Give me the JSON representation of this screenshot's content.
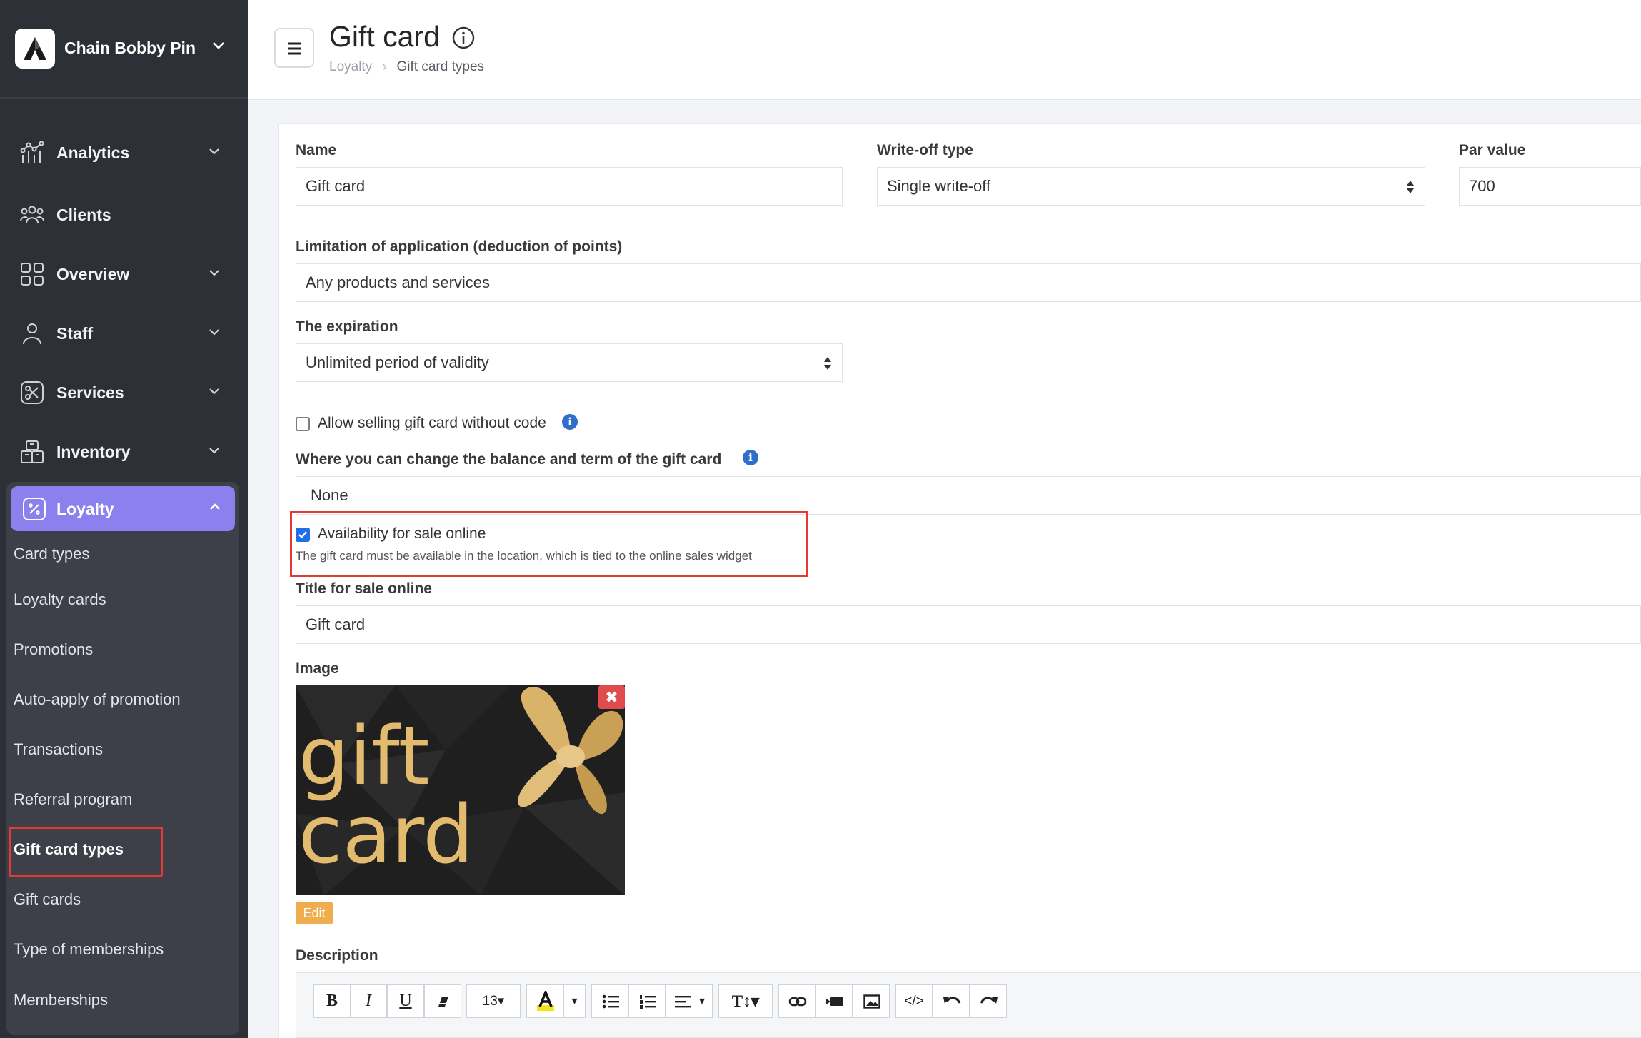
{
  "brand": {
    "name": "Chain Bobby Pin"
  },
  "sidebar": {
    "items": [
      {
        "label": "Analytics",
        "icon": "analytics-icon",
        "has_chevron": true
      },
      {
        "label": "Clients",
        "icon": "clients-icon",
        "has_chevron": false
      },
      {
        "label": "Overview",
        "icon": "overview-icon",
        "has_chevron": true
      },
      {
        "label": "Staff",
        "icon": "staff-icon",
        "has_chevron": true
      },
      {
        "label": "Services",
        "icon": "services-icon",
        "has_chevron": true
      },
      {
        "label": "Inventory",
        "icon": "inventory-icon",
        "has_chevron": true
      }
    ],
    "loyalty": {
      "label": "Loyalty",
      "icon": "loyalty-icon",
      "accent_color": "#8a80ee",
      "sub_items": [
        {
          "label": "Card types",
          "active": false
        },
        {
          "label": "Loyalty cards",
          "active": false
        },
        {
          "label": "Promotions",
          "active": false
        },
        {
          "label": "Auto-apply of promotion",
          "active": false
        },
        {
          "label": "Transactions",
          "active": false
        },
        {
          "label": "Referral program",
          "active": false
        },
        {
          "label": "Gift card types",
          "active": true
        },
        {
          "label": "Gift cards",
          "active": false
        },
        {
          "label": "Type of memberships",
          "active": false
        },
        {
          "label": "Memberships",
          "active": false
        }
      ]
    }
  },
  "header": {
    "title": "Gift card",
    "breadcrumb": {
      "parent": "Loyalty",
      "current": "Gift card types"
    }
  },
  "form": {
    "name": {
      "label": "Name",
      "value": "Gift card"
    },
    "writeoff": {
      "label": "Write-off type",
      "value": "Single write-off"
    },
    "par_value": {
      "label": "Par value",
      "value": "700"
    },
    "limitation": {
      "label": "Limitation of application (deduction of points)",
      "value": "Any products and services"
    },
    "expiration": {
      "label": "The expiration",
      "value": "Unlimited period of validity"
    },
    "allow_without_code": {
      "label": "Allow selling gift card without code",
      "checked": false
    },
    "balance_change": {
      "label": "Where you can change the balance and term of the gift card",
      "value": "None"
    },
    "online_sale": {
      "label": "Availability for sale online",
      "checked": true,
      "hint": "The gift card must be available in the location, which is tied to the online sales widget"
    },
    "online_title": {
      "label": "Title for sale online",
      "value": "Gift card"
    },
    "image": {
      "label": "Image",
      "line1": "gift",
      "line2": "card",
      "edit_label": "Edit",
      "remove_glyph": "✖"
    },
    "description": {
      "label": "Description",
      "font_size": "13",
      "toolbar": [
        "bold",
        "italic",
        "underline",
        "eraser",
        "font-size",
        "highlight",
        "highlight-dropdown",
        "bullet-list",
        "numbered-list",
        "align",
        "text-height",
        "link",
        "video",
        "image",
        "code-view",
        "undo",
        "redo"
      ]
    }
  },
  "colors": {
    "sidebar_bg": "#2d3036",
    "highlight_red": "#e53935",
    "checkbox_blue": "#1e6fe8",
    "edit_orange": "#f0ad4e"
  }
}
